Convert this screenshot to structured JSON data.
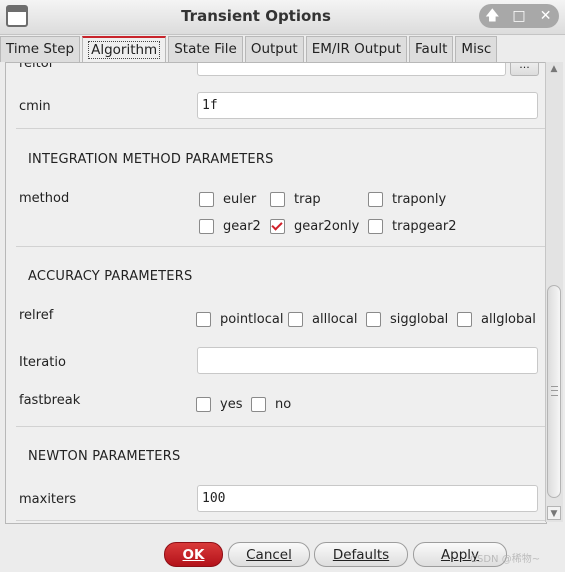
{
  "window": {
    "title": "Transient Options",
    "controls": [
      "🡅",
      "□",
      "✕"
    ]
  },
  "tabs": [
    {
      "label": "Time Step"
    },
    {
      "label": "Algorithm",
      "active": true
    },
    {
      "label": "State File"
    },
    {
      "label": "Output"
    },
    {
      "label": "EM/IR Output"
    },
    {
      "label": "Fault"
    },
    {
      "label": "Misc"
    }
  ],
  "form": {
    "reltol_partial_label": "reltol",
    "cmin_label": "cmin",
    "cmin_value": "1f",
    "integration_heading": "INTEGRATION METHOD PARAMETERS",
    "method_label": "method",
    "methods": {
      "euler": "euler",
      "trap": "trap",
      "traponly": "traponly",
      "gear2": "gear2",
      "gear2only": "gear2only",
      "trapgear2": "trapgear2"
    },
    "method_checked": "gear2only",
    "accuracy_heading": "ACCURACY PARAMETERS",
    "relref_label": "relref",
    "relref": {
      "pointlocal": "pointlocal",
      "alllocal": "alllocal",
      "sigglobal": "sigglobal",
      "allglobal": "allglobal"
    },
    "iteratio_label": "Iteratio",
    "iteratio_value": "",
    "fastbreak_label": "fastbreak",
    "fastbreak": {
      "yes": "yes",
      "no": "no"
    },
    "newton_heading": "NEWTON PARAMETERS",
    "maxiters_label": "maxiters",
    "maxiters_value": "100",
    "ellipsis": "..."
  },
  "buttons": {
    "ok": "OK",
    "cancel": "Cancel",
    "defaults": "Defaults",
    "apply": "Apply"
  },
  "watermark": "CSDN @稀物~",
  "colors": {
    "accent": "#c8242b"
  }
}
